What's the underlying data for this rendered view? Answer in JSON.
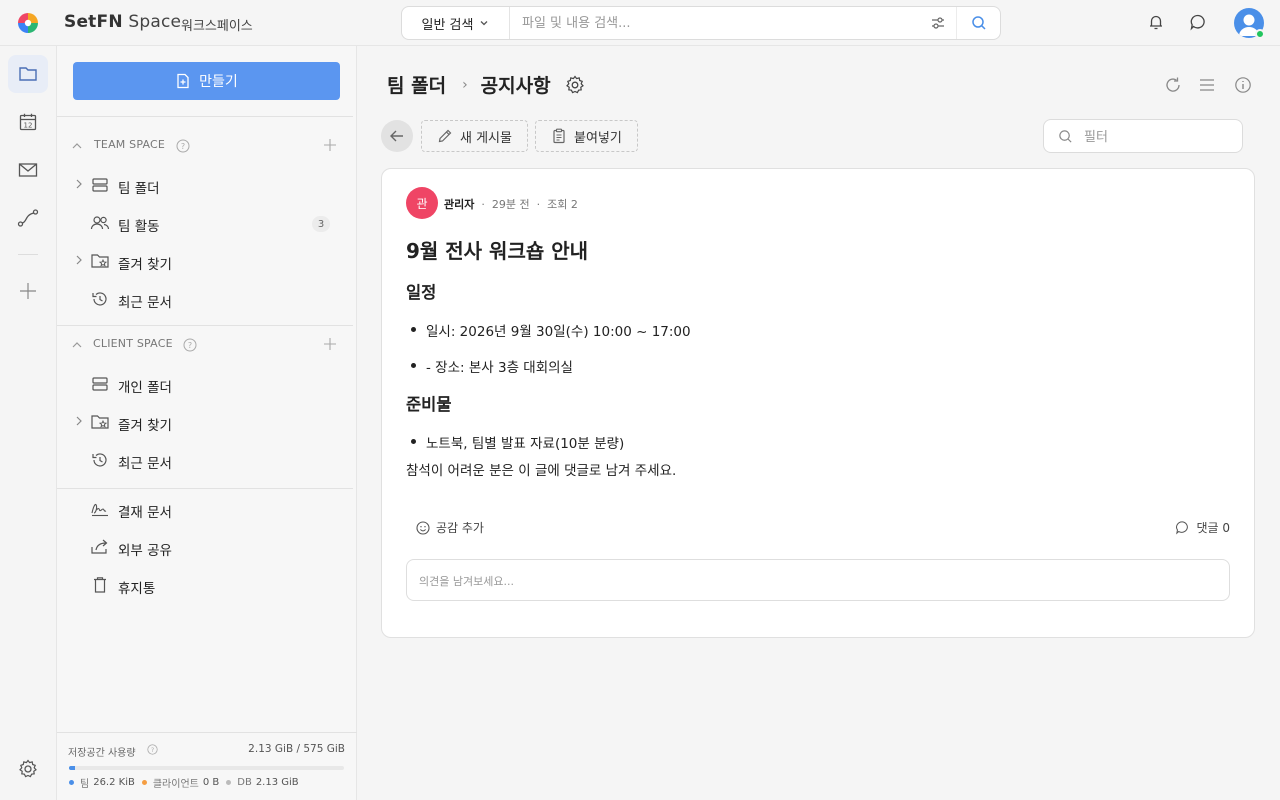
{
  "header": {
    "brand_bold": "SetFN",
    "brand_rest": "Space",
    "workspace_label": "워크스페이스",
    "search_type": "일반 검색",
    "search_placeholder": "파일 및 내용 검색...",
    "accent_color": "#5b96f0"
  },
  "rail": {
    "items": [
      "folder-icon",
      "calendar-icon",
      "mail-icon",
      "workflow-icon",
      "plus-icon"
    ],
    "active": "folder-icon",
    "calendar_day": "12"
  },
  "sidebar": {
    "create_label": "만들기",
    "team_space": {
      "title": "TEAM SPACE",
      "items": [
        {
          "label": "팀 폴더",
          "icon": "server-icon",
          "expandable": true
        },
        {
          "label": "팀 활동",
          "icon": "people-icon",
          "badge": "3"
        },
        {
          "label": "즐겨 찾기",
          "icon": "star-folder-icon",
          "expandable": true
        },
        {
          "label": "최근 문서",
          "icon": "history-icon"
        }
      ]
    },
    "client_space": {
      "title": "CLIENT SPACE",
      "items": [
        {
          "label": "개인 폴더",
          "icon": "server-icon"
        },
        {
          "label": "즐겨 찾기",
          "icon": "star-folder-icon",
          "expandable": true
        },
        {
          "label": "최근 문서",
          "icon": "history-icon"
        }
      ]
    },
    "extra_items": [
      {
        "label": "결재 문서",
        "icon": "signature-icon"
      },
      {
        "label": "외부 공유",
        "icon": "share-icon"
      },
      {
        "label": "휴지통",
        "icon": "trash-icon"
      }
    ],
    "storage": {
      "label": "저장공간 사용량",
      "value": "2.13 GiB / 575 GiB",
      "used_fraction": 0.0037,
      "legend": [
        {
          "name": "팀",
          "value": "26.2 KiB",
          "color": "#4a8fe8"
        },
        {
          "name": "클라이언트",
          "value": "0 B",
          "color": "#f59e42"
        },
        {
          "name": "DB",
          "value": "2.13 GiB",
          "color": "#bbbbbb"
        }
      ]
    }
  },
  "main": {
    "breadcrumb": [
      "팀 폴더",
      "공지사항"
    ],
    "actions": {
      "new_post": "새 게시물",
      "paste": "붙여넣기"
    },
    "filter_placeholder": "필터",
    "post": {
      "avatar_char": "관",
      "author": "관리자",
      "time": "29분 전",
      "views": "조회 2",
      "title": "9월 전사 워크숍 안내",
      "section1": "일정",
      "item1": "일시: 2026년 9월 30일(수) 10:00 ~ 17:00",
      "item2": "- 장소: 본사 3층 대회의실",
      "section2": "준비물",
      "item3": "노트북, 팀별 발표 자료(10분 분량)",
      "paragraph": "참석이 어려운 분은 이 글에 댓글로 남겨 주세요.",
      "reaction_label": "공감 추가",
      "comments_label": "댓글 0",
      "comment_placeholder": "의견을 남겨보세요..."
    }
  }
}
